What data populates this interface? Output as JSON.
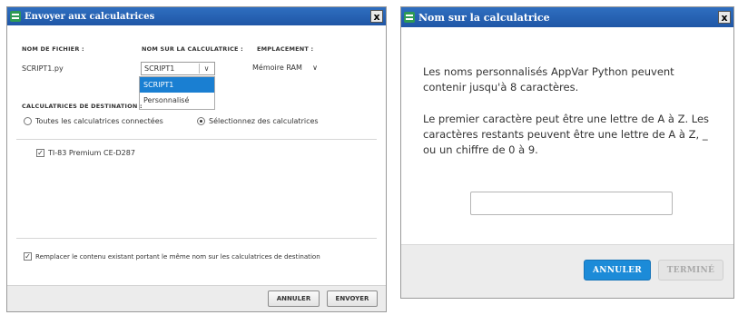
{
  "send_dialog": {
    "title": "Envoyer aux calculatrices",
    "close_label": "x",
    "columns": {
      "filename": "NOM DE FICHIER :",
      "calc_name": "NOM SUR LA CALCULATRICE :",
      "location": "EMPLACEMENT :"
    },
    "file": {
      "filename": "SCRIPT1.py",
      "calc_name_value": "SCRIPT1",
      "location_value": "Mémoire RAM"
    },
    "name_dropdown_options": [
      "SCRIPT1",
      "Personnalisé"
    ],
    "dest_header": "CALCULATRICES DE DESTINATION :",
    "radio_all": "Toutes les calculatrices connectées",
    "radio_select": "Sélectionnez des calculatrices",
    "calculators": [
      "TI-83 Premium CE-D287"
    ],
    "replace_label": "Remplacer le contenu existant portant le même nom sur les calculatrices de destination",
    "cancel_label": "ANNULER",
    "send_label": "ENVOYER"
  },
  "name_dialog": {
    "title": "Nom sur la calculatrice",
    "close_label": "x",
    "para1": "Les noms personnalisés AppVar Python peuvent contenir jusqu'à 8 caractères.",
    "para2": "Le premier caractère peut être une lettre de A à Z. Les caractères restants peuvent être une lettre de A à Z, _ ou un chiffre de 0 à 9.",
    "input_value": "",
    "cancel_label": "ANNULER",
    "done_label": "TERMINÉ"
  },
  "colors": {
    "titlebar": "#1f56a6",
    "dropdown_selected": "#1a7fd2",
    "primary_button": "#1c8bd8"
  }
}
